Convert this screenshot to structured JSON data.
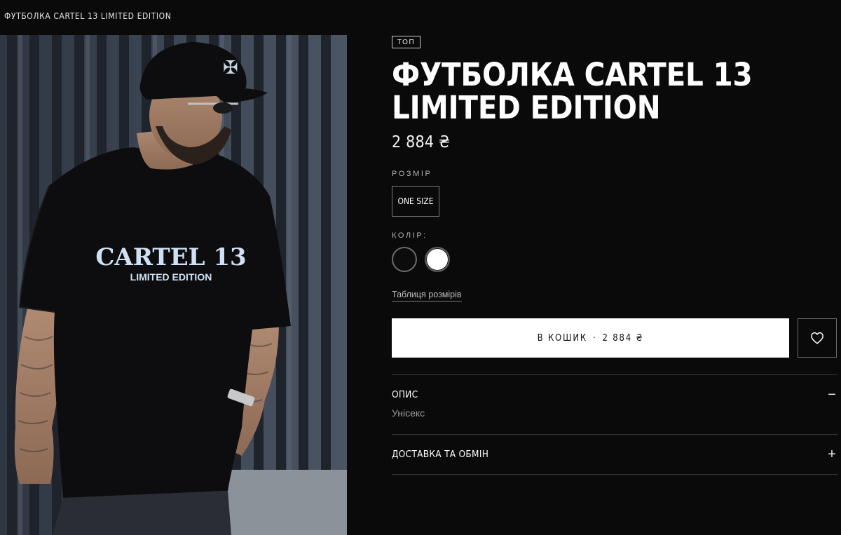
{
  "breadcrumb": {
    "current": "ФУТБОЛКА CARTEL 13 LIMITED EDITION"
  },
  "photo": {
    "print_line1": "CARTEL 13",
    "print_line2": "LIMITED EDITION"
  },
  "product": {
    "badge": "ТОП",
    "title": "ФУТБОЛКА CARTEL 13 LIMITED EDITION",
    "price": "2 884 ₴"
  },
  "size": {
    "label": "РОЗМІР",
    "options": [
      "ONE SIZE"
    ]
  },
  "color": {
    "label": "КОЛІР:",
    "swatches": [
      {
        "name": "black",
        "hex": "#0c0c0c"
      },
      {
        "name": "white",
        "hex": "#ffffff"
      }
    ]
  },
  "size_table_link": "Таблиця розмірів",
  "cart": {
    "label": "В КОШИК",
    "separator": "·",
    "price": "2 884 ₴"
  },
  "wishlist_icon": "heart-icon",
  "accordion": [
    {
      "title": "ОПИС",
      "toggle": "−",
      "body": "Унісекс"
    },
    {
      "title": "ДОСТАВКА ТА ОБМІН",
      "toggle": "+"
    }
  ]
}
